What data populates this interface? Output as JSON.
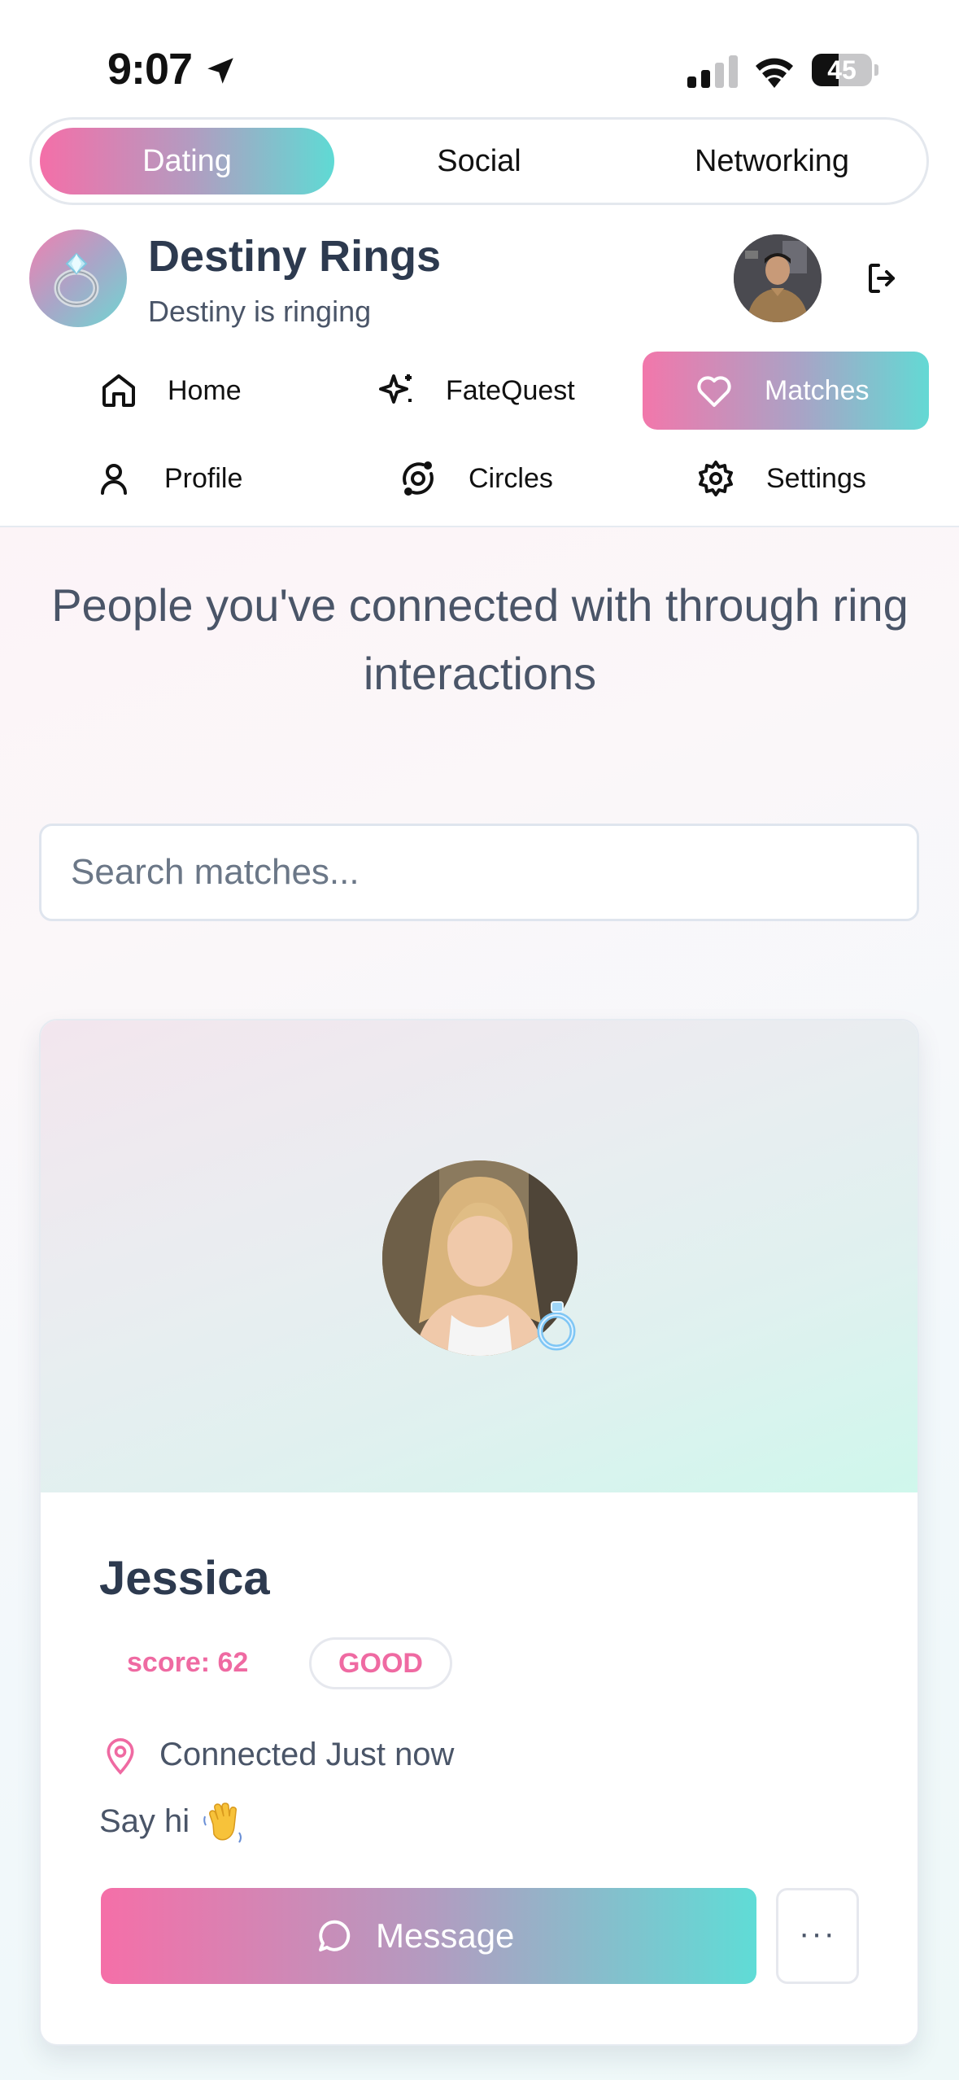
{
  "status_bar": {
    "time": "9:07",
    "battery_percent": "45",
    "battery_level": 0.45
  },
  "mode_tabs": [
    {
      "label": "Dating",
      "active": true
    },
    {
      "label": "Social",
      "active": false
    },
    {
      "label": "Networking",
      "active": false
    }
  ],
  "brand": {
    "title": "Destiny Rings",
    "subtitle": "Destiny is ringing"
  },
  "nav": {
    "items": [
      {
        "label": "Home",
        "icon": "home-icon",
        "active": false
      },
      {
        "label": "FateQuest",
        "icon": "sparkles-icon",
        "active": false
      },
      {
        "label": "Matches",
        "icon": "heart-icon",
        "active": true
      },
      {
        "label": "Profile",
        "icon": "user-icon",
        "active": false
      },
      {
        "label": "Circles",
        "icon": "circles-icon",
        "active": false
      },
      {
        "label": "Settings",
        "icon": "gear-icon",
        "active": false
      }
    ]
  },
  "page": {
    "subtitle": "People you've connected with through ring interactions"
  },
  "search": {
    "placeholder": "Search matches..."
  },
  "match": {
    "name": "Jessica",
    "score_text": "score: 62",
    "quality": "GOOD",
    "connected_text": "Connected Just now",
    "greeting": "Say hi",
    "message_label": "Message",
    "more_label": "···"
  },
  "colors": {
    "accent_pink": "#f46fa8",
    "accent_teal": "#5fdad4",
    "text_dark": "#2d3a4f"
  }
}
